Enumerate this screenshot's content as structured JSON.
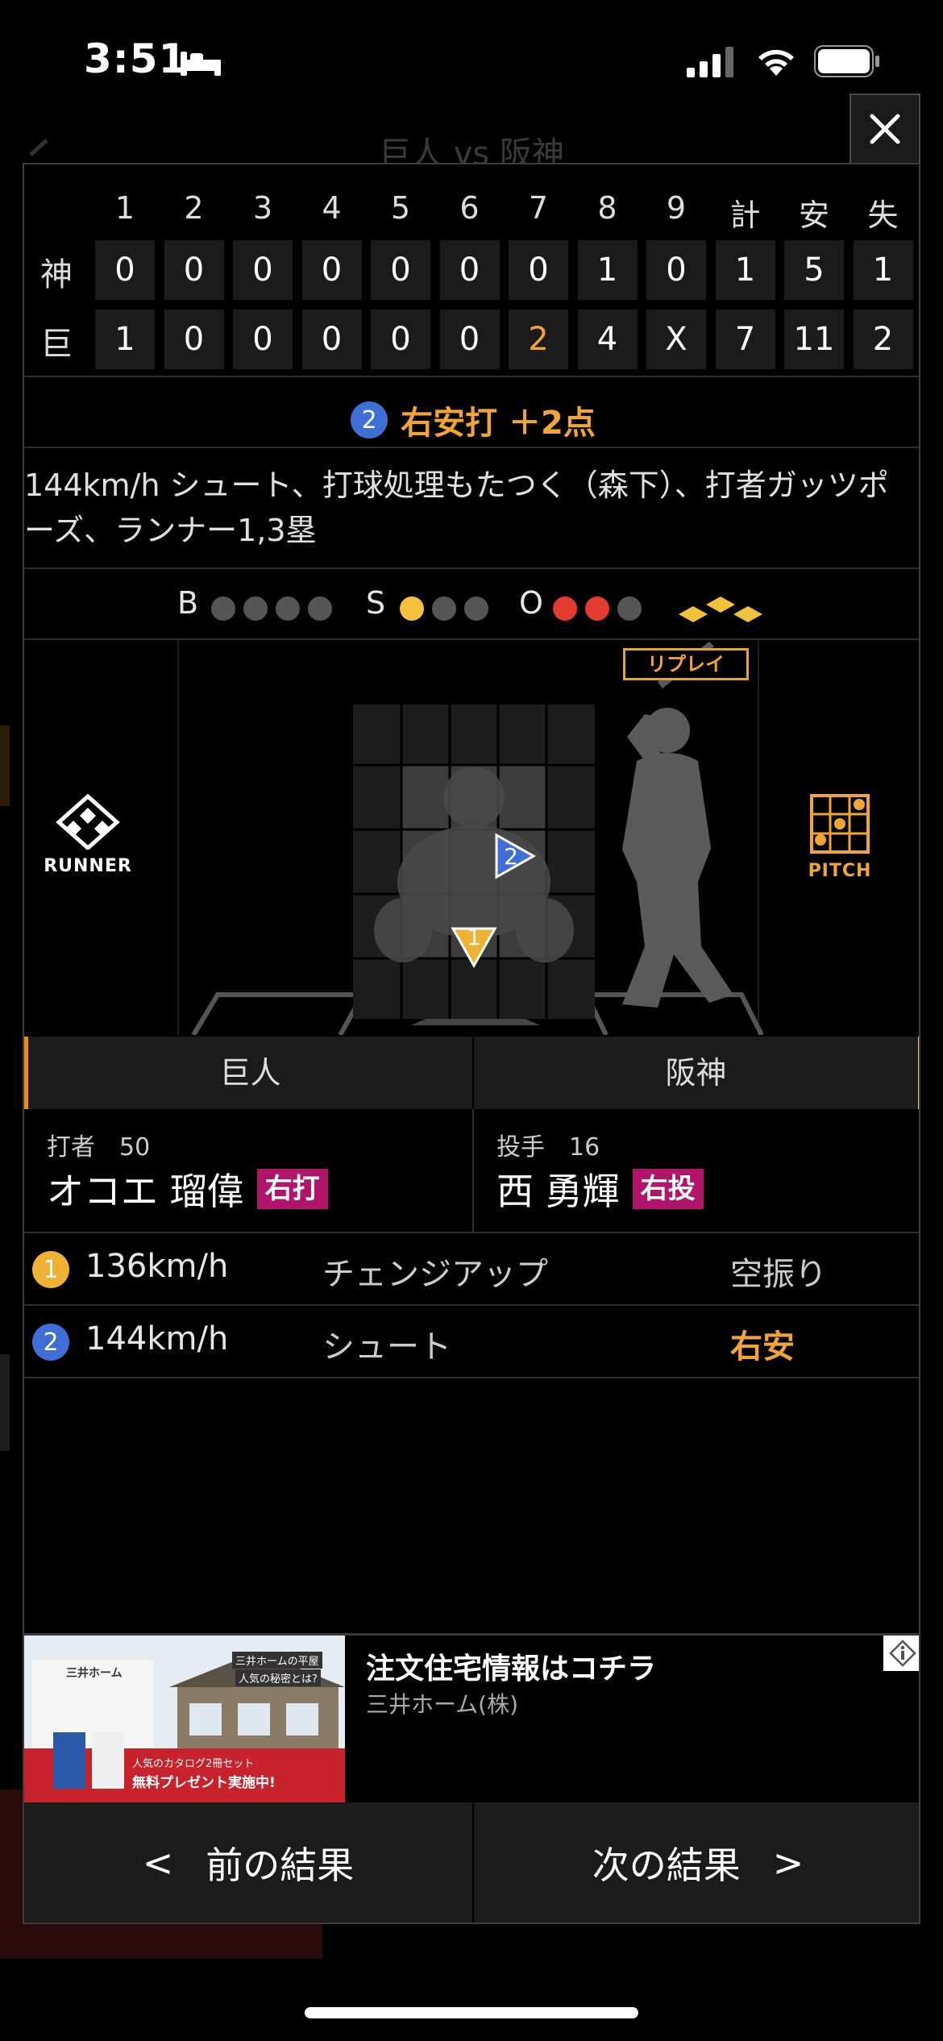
{
  "status_bar": {
    "time": "3:51"
  },
  "background": {
    "title": "巨人 vs 阪神"
  },
  "scoreboard": {
    "headers": [
      "1",
      "2",
      "3",
      "4",
      "5",
      "6",
      "7",
      "8",
      "9",
      "計",
      "安",
      "失"
    ],
    "rows": [
      {
        "team": "神",
        "cells": [
          "0",
          "0",
          "0",
          "0",
          "0",
          "0",
          "0",
          "1",
          "0",
          "1",
          "5",
          "1"
        ]
      },
      {
        "team": "巨",
        "cells": [
          "1",
          "0",
          "0",
          "0",
          "0",
          "0",
          "2",
          "4",
          "X",
          "7",
          "11",
          "2"
        ]
      }
    ]
  },
  "play": {
    "number": "2",
    "headline": "右安打 ＋2点",
    "description": "144km/h シュート、打球処理もたつく（森下）、打者ガッツポーズ、ランナー1,3塁"
  },
  "count": {
    "balls_label": "B",
    "balls": 0,
    "balls_max": 4,
    "strikes_label": "S",
    "strikes": 1,
    "strikes_max": 3,
    "outs_label": "O",
    "outs": 2,
    "outs_max": 3
  },
  "field": {
    "runner_label": "RUNNER",
    "pitch_label": "PITCH",
    "replay_label": "リプレイ",
    "markers": [
      {
        "number": "1",
        "shape": "triangle-down",
        "color": "#f0b232"
      },
      {
        "number": "2",
        "shape": "triangle-right",
        "color": "#3f6fd6"
      }
    ]
  },
  "teams": {
    "left": "巨人",
    "right": "阪神",
    "left_color": "#f08b1a",
    "right_color": "#f3c52d"
  },
  "batter": {
    "role": "打者　50",
    "name": "オコエ 瑠偉",
    "hand": "右打"
  },
  "pitcher": {
    "role": "投手　16",
    "name": "西 勇輝",
    "hand": "右投"
  },
  "pitches": [
    {
      "number": "1",
      "speed": "136km/h",
      "type": "チェンジアップ",
      "result": "空振り",
      "badge_color": "yellow",
      "is_hit": false
    },
    {
      "number": "2",
      "speed": "144km/h",
      "type": "シュート",
      "result": "右安",
      "badge_color": "blue",
      "is_hit": true
    }
  ],
  "ad": {
    "headline": "注文住宅情報はコチラ",
    "sponsor": "三井ホーム(株)",
    "image_brand": "三井ホーム",
    "image_tag": "三井ホームの平屋",
    "image_sub": "人気の秘密とは?",
    "image_banner_1": "人気のカタログ2冊セット",
    "image_banner_2": "無料プレゼント実施中!"
  },
  "nav": {
    "prev_arrow": "<",
    "prev_label": "前の結果",
    "next_label": "次の結果",
    "next_arrow": ">"
  },
  "colors": {
    "accent": "#f3a533",
    "strike": "#f3c23a",
    "out": "#e53a30",
    "hand_badge": "#b0156b"
  }
}
